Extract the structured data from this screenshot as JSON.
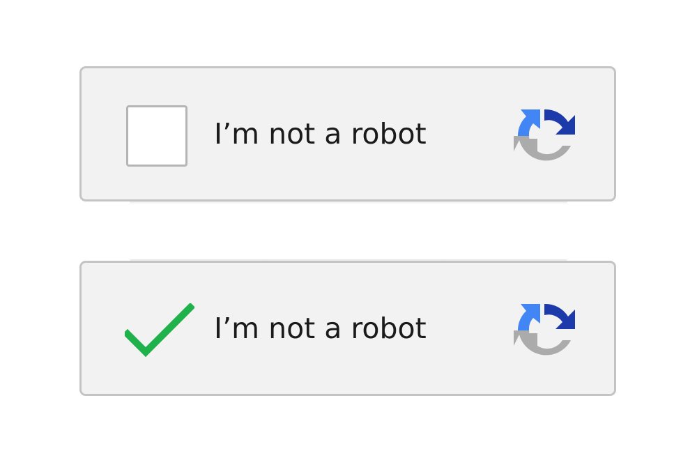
{
  "captchas": [
    {
      "state": "unchecked",
      "label": "I’m not a robot",
      "logo_icon": "recaptcha-logo-icon"
    },
    {
      "state": "checked",
      "label": "I’m not a robot",
      "status_icon": "checkmark-icon",
      "logo_icon": "recaptcha-logo-icon"
    }
  ],
  "colors": {
    "box_background": "#f2f2f2",
    "box_border": "#c4c4c4",
    "checkbox_border": "#b5b5b5",
    "checkmark_green": "#1fb14a",
    "logo_blue_dark": "#1c3aa9",
    "logo_blue_light": "#4285f4",
    "logo_gray": "#ababab",
    "text": "#1a1a1a"
  }
}
